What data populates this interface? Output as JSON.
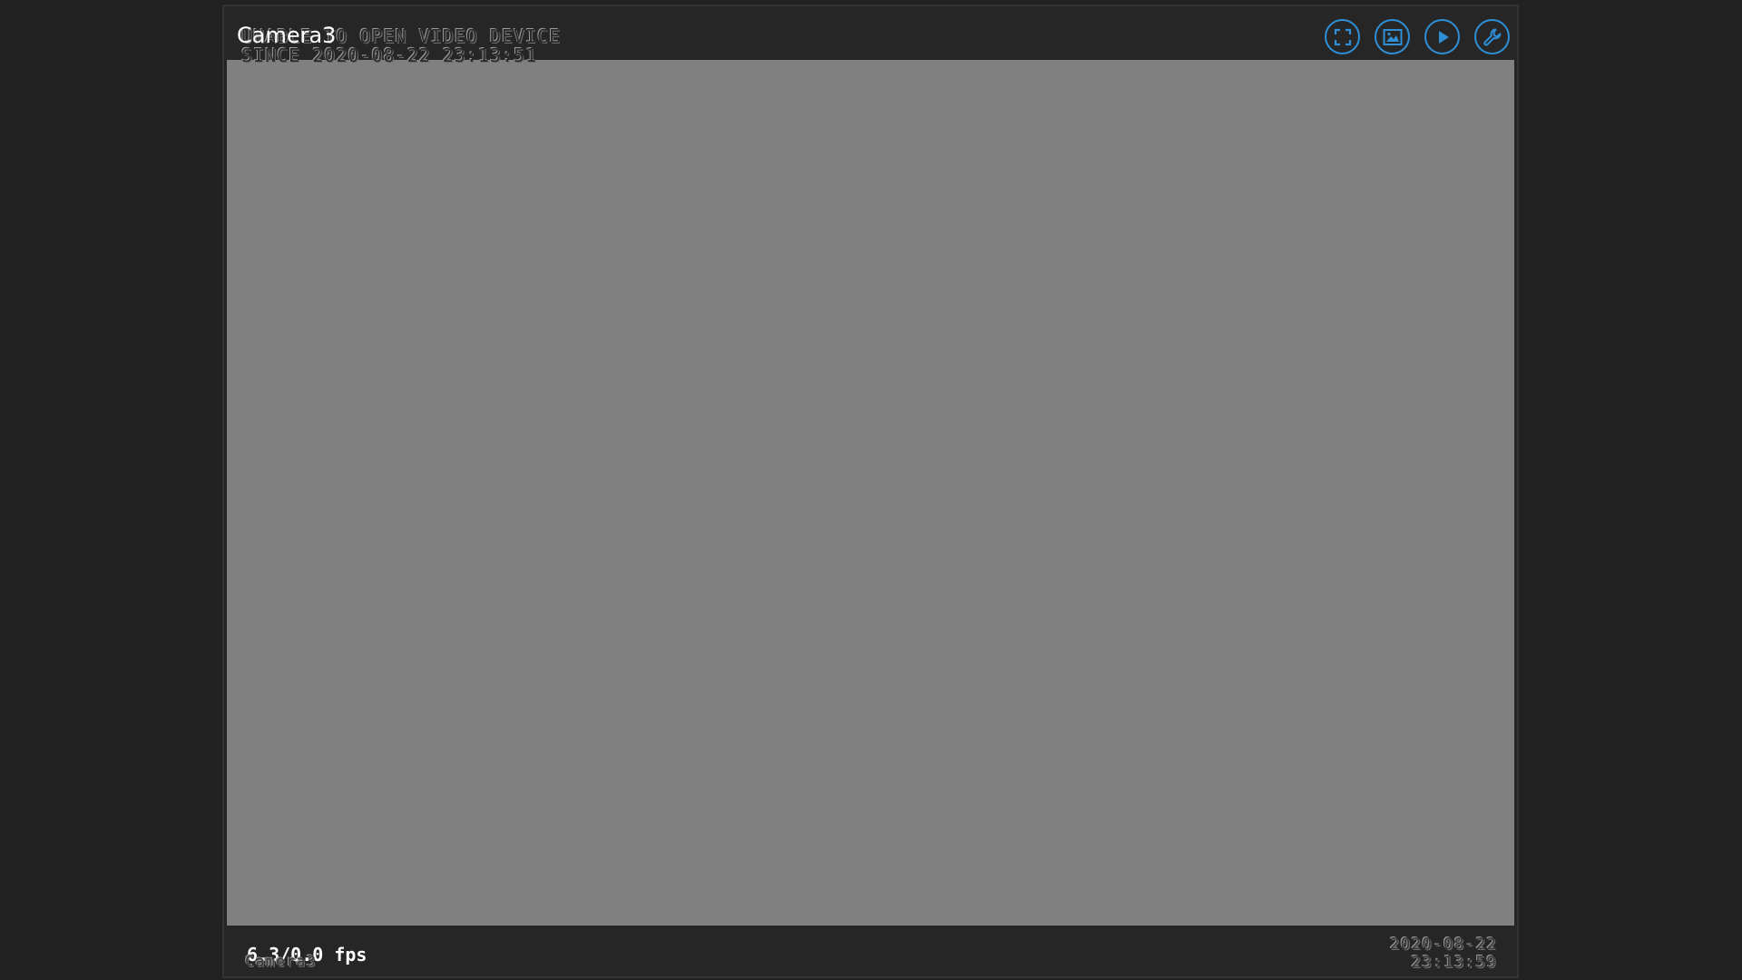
{
  "camera": {
    "title": "Camera3"
  },
  "toolbar": {
    "buttons": [
      {
        "icon": "fullscreen-icon"
      },
      {
        "icon": "snapshot-icon"
      },
      {
        "icon": "play-icon"
      },
      {
        "icon": "wrench-icon"
      }
    ],
    "accent_color": "#2f8fd6"
  },
  "video": {
    "osd_line1": "UNABLE TO OPEN VIDEO DEVICE",
    "osd_line2": "SINCE 2020-08-22 23:13:51",
    "osd_camera_name": "Camera3",
    "osd_date": "2020-08-22",
    "osd_time": "23:13:59",
    "background_color": "#808080"
  },
  "status": {
    "fps": "6.3/0.0 fps"
  }
}
